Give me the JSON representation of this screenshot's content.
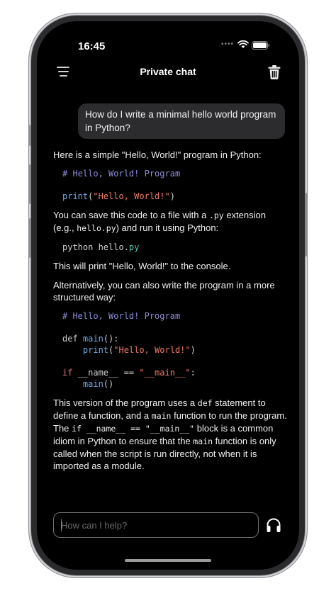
{
  "status": {
    "time": "16:45",
    "signal": "••••"
  },
  "header": {
    "title": "Private chat"
  },
  "user_message": "How do I write a minimal hello world program in Python?",
  "assistant": {
    "intro": "Here is a simple \"Hello, World!\" program in Python:",
    "code1_comment": "# Hello, World! Program",
    "code1_fn": "print",
    "code1_open": "(",
    "code1_str": "\"Hello, World!\"",
    "code1_close": ")",
    "save_a": "You can save this code to a file with a ",
    "save_ext": ".py",
    "save_b": " extension (e.g., ",
    "save_file": "hello.py",
    "save_c": ") and run it using Python:",
    "run_cmd": "python hello.",
    "run_ext": "py",
    "prints": "This will print \"Hello, World!\" to the console.",
    "alt": "Alternatively, you can also write the program in a more structured way:",
    "code2_comment": "# Hello, World! Program",
    "code2_def": "def ",
    "code2_main": "main",
    "code2_paren": "():",
    "code2_print": "print",
    "code2_open": "(",
    "code2_str": "\"Hello, World!\"",
    "code2_close": ")",
    "code2_if": "if",
    "code2_name": " __name__ == ",
    "code2_main_str": "\"__main__\"",
    "code2_colon": ":",
    "code2_call": "main",
    "code2_call_paren": "()",
    "expl_a": "This version of the program uses a ",
    "expl_def": "def",
    "expl_b": " statement to define a function, and a ",
    "expl_main": "main",
    "expl_c": " function to run the program. The ",
    "expl_if": "if __name__ == \"__main__\"",
    "expl_d": " block is a common idiom in Python to ensure that the ",
    "expl_main2": "main",
    "expl_e": " function is only called when the script is run directly, not when it is imported as a module."
  },
  "input": {
    "placeholder": "How can I help?"
  }
}
